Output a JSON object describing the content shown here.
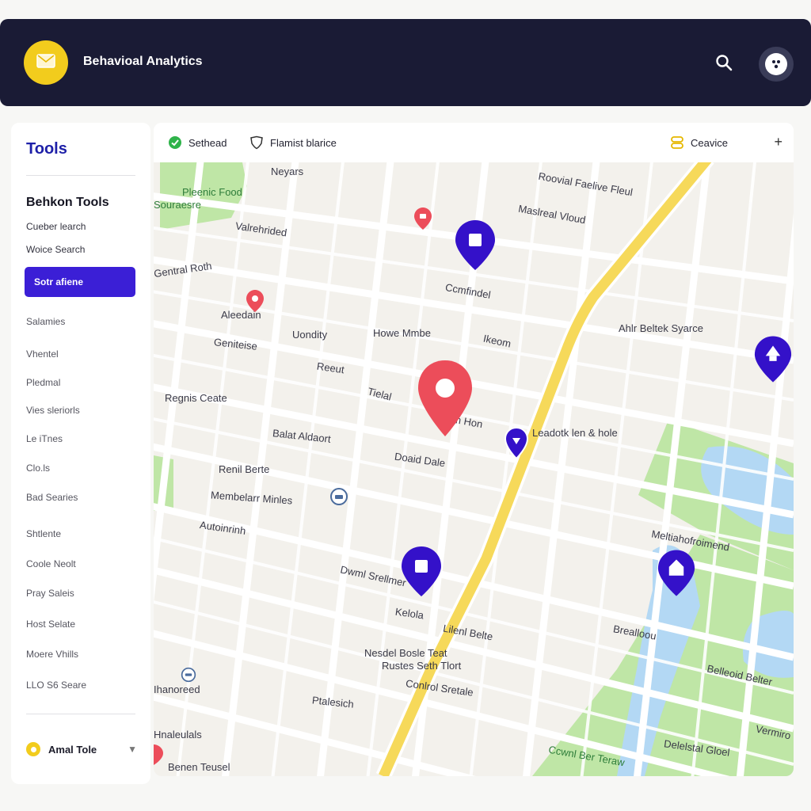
{
  "header": {
    "title": "Behavioal Analytics",
    "logo_icon": "mail-icon",
    "search_icon": "search-icon",
    "user_icon": "user-avatar-icon"
  },
  "sidebar": {
    "heading": "Tools",
    "subheading": "Behkon Tools",
    "items": [
      "Cueber learch",
      "Woice Search"
    ],
    "active_item": "Sotr afiene",
    "list": [
      "Salamies",
      "Vhentel",
      "Pledmal",
      "Vies sleriorls",
      "Le iTnes",
      "Clo.ls",
      "Bad Searies",
      "Shtlente",
      "Coole Neolt",
      "Pray Saleis",
      "Host Selate",
      "Moere Vhills",
      "LLO S6 Seare"
    ],
    "bottom_item": "Amal Tole"
  },
  "toolbar": {
    "item1": "Sethead",
    "item2": "Flamist blarice",
    "item3": "Ceavice",
    "plus": "+"
  },
  "map": {
    "labels": [
      "Neyars",
      "Pleenic Food",
      "Souraesre",
      "Valrehrided",
      "Roovial Faelive Fleul",
      "Maslreal Vloud",
      "Ccmfindel",
      "Ahlr Beltek Syarce",
      "Aleedain",
      "Uondity",
      "Howe Mmbe",
      "Ikeom",
      "Geniteise",
      "Reeut",
      "Regnis Ceate",
      "Tielal",
      "Clolm Hon",
      "Leadotk len & hole",
      "Balat Aldaort",
      "Doaid Dale",
      "Renil Berte",
      "Membelarr Minles",
      "Autoinrinh",
      "Dwml Srellmer",
      "Kelola",
      "Lilenl Belte",
      "Nesdel Bosle Teat",
      "Rustes Seth Tlort",
      "Conlrol Sretale",
      "Meltiahofroimend",
      "Brealloou",
      "Belleoid Belter",
      "Ihanoreed",
      "Ptalesich",
      "Hnaleulals",
      "Benen Teusel",
      "Vermiro",
      "Delelstal Gloel",
      "Ccwnl Ber Teraw",
      "Gentral Roth"
    ]
  },
  "colors": {
    "header_bg": "#1a1b35",
    "accent_yellow": "#f2cc1d",
    "accent_blue": "#3b1fd6",
    "pin_red": "#ec4d5a",
    "pin_purple": "#3411c9",
    "road_yellow": "#f6d95a",
    "park_green": "#bfe6a6",
    "water_blue": "#b3d8f4"
  }
}
